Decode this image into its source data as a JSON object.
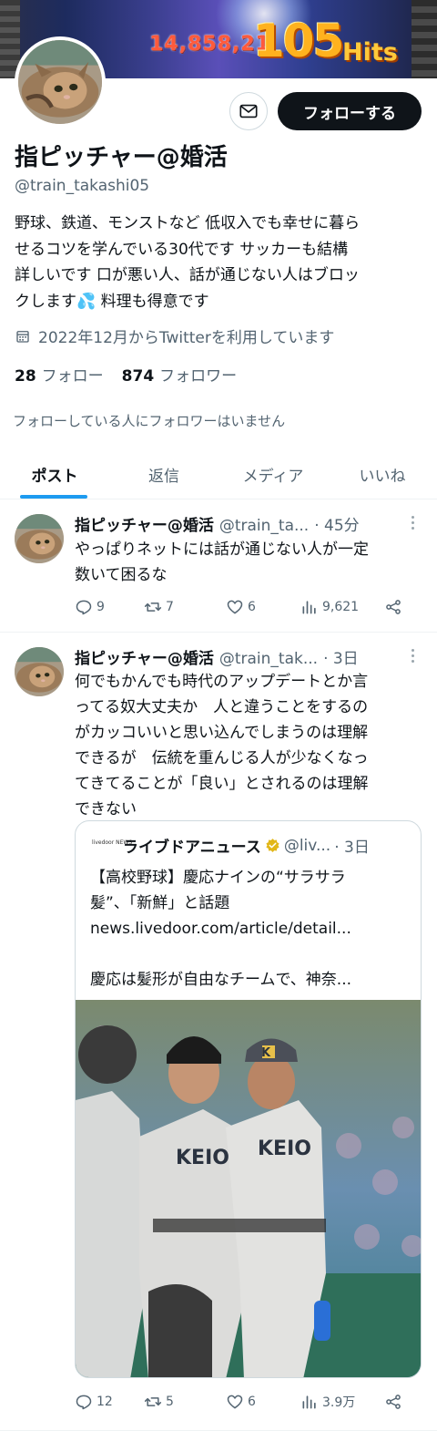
{
  "banner": {
    "score_text": "14,858,21",
    "hits_number": "105",
    "hits_word": "Hits"
  },
  "profile": {
    "follow_label": "フォローする",
    "name": "指ピッチャー@婚活",
    "handle": "@train_takashi05",
    "bio_lines": [
      "野球、鉄道、モンストなど 低収入でも幸せに暮ら",
      "せるコツを学んでいる30代です サッカーも結構",
      "詳しいです 口が悪い人、話が通じない人はブロッ",
      "クします💦 料理も得意です"
    ],
    "joined": "2022年12月からTwitterを利用しています",
    "following_count": "28",
    "following_label": "フォロー",
    "followers_count": "874",
    "followers_label": "フォロワー",
    "followers_you_know": "フォローしている人にフォロワーはいません"
  },
  "tabs": [
    "ポスト",
    "返信",
    "メディア",
    "いいね"
  ],
  "posts": [
    {
      "name": "指ピッチャー@婚活",
      "handle": "@train_ta...",
      "time": "· 45分",
      "text_lines": [
        "やっぱりネットには話が通じない人が一定",
        "数いて困るな"
      ],
      "replies": "9",
      "reposts": "7",
      "likes": "6",
      "views": "9,621"
    },
    {
      "name": "指ピッチャー@婚活",
      "handle": "@train_tak...",
      "time": "· 3日",
      "text_lines": [
        "何でもかんでも時代のアップデートとか言",
        "ってる奴大丈夫か　人と違うことをするの",
        "がカッコいいと思い込んでしまうのは理解",
        "できるが　伝統を重んじる人が少なくなっ",
        "てきてることが「良い」とされるのは理解",
        "できない"
      ],
      "quote": {
        "logo_text": "livedoor NEWS",
        "name": "ライブドアニュース",
        "handle": "@liv...",
        "time": "· 3日",
        "headline_lines": [
          "【高校野球】慶応ナインの“サラサラ",
          "髪”、「新鮮」と話題"
        ],
        "link": "news.livedoor.com/article/detail...",
        "summary": "慶応は髪形が自由なチームで、神奈...",
        "photo_jersey": "KEIO",
        "photo_cap_letter": "K"
      },
      "replies": "12",
      "reposts": "5",
      "likes": "6",
      "views": "3.9万"
    }
  ],
  "colors": {
    "accent": "#1d9bf0",
    "text": "#0f1419",
    "secondary": "#536471",
    "verified_gold": "#e2b719"
  },
  "icons": [
    "mail-icon",
    "calendar-icon",
    "reply-icon",
    "repost-icon",
    "like-icon",
    "views-icon",
    "share-icon",
    "more-icon",
    "verified-badge-icon"
  ]
}
